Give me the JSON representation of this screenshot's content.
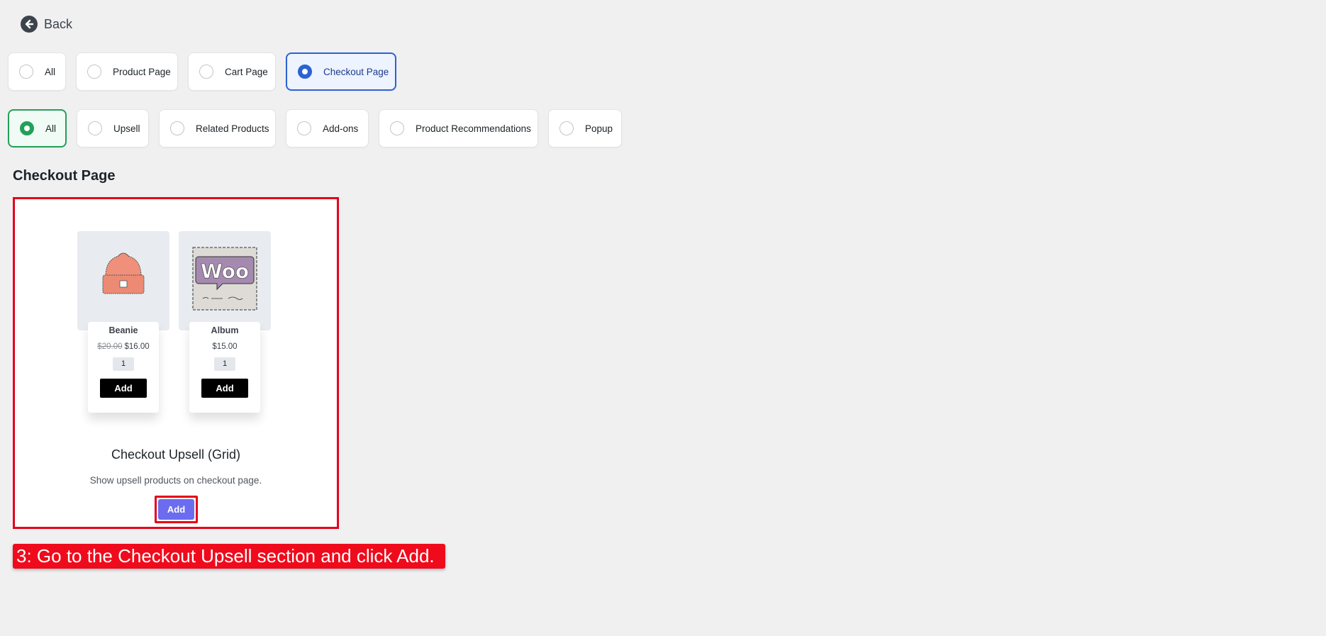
{
  "back": {
    "label": "Back",
    "icon": "arrow-left-circle-icon"
  },
  "location_filters": [
    {
      "label": "All",
      "selected": false
    },
    {
      "label": "Product Page",
      "selected": false
    },
    {
      "label": "Cart Page",
      "selected": false
    },
    {
      "label": "Checkout Page",
      "selected": true
    }
  ],
  "type_filters": [
    {
      "label": "All",
      "selected": true
    },
    {
      "label": "Upsell",
      "selected": false
    },
    {
      "label": "Related Products",
      "selected": false
    },
    {
      "label": "Add-ons",
      "selected": false
    },
    {
      "label": "Product Recommendations",
      "selected": false
    },
    {
      "label": "Popup",
      "selected": false
    }
  ],
  "section_title": "Checkout Page",
  "card": {
    "products": [
      {
        "name": "Beanie",
        "old_price": "$20.00",
        "price": "$16.00",
        "qty": "1",
        "add_label": "Add",
        "image": "beanie-image"
      },
      {
        "name": "Album",
        "old_price": "",
        "price": "$15.00",
        "qty": "1",
        "add_label": "Add",
        "image": "woo-album-image",
        "image_text": "Woo"
      }
    ],
    "title": "Checkout Upsell (Grid)",
    "description": "Show upsell products on checkout page.",
    "add_label": "Add"
  },
  "instruction": "3: Go to the Checkout Upsell section and click Add.",
  "colors": {
    "selected_blue": "#2c63d1",
    "selected_green": "#22a05a",
    "highlight_red": "#e3001b",
    "add_button": "#6c6cf0"
  }
}
